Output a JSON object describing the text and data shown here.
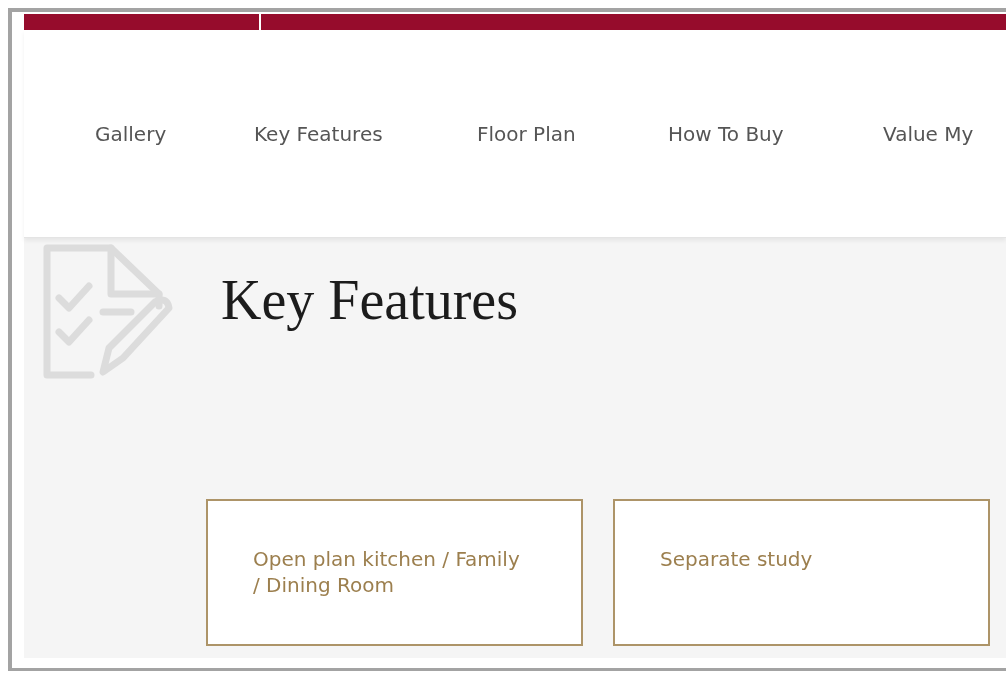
{
  "nav": {
    "items": [
      {
        "label": "Gallery"
      },
      {
        "label": "Key Features"
      },
      {
        "label": "Floor Plan"
      },
      {
        "label": "How To Buy"
      },
      {
        "label": "Value My"
      }
    ]
  },
  "section": {
    "title": "Key Features",
    "features": [
      {
        "label": "Open plan kitchen / Family / Dining Room"
      },
      {
        "label": "Separate study"
      }
    ]
  }
}
